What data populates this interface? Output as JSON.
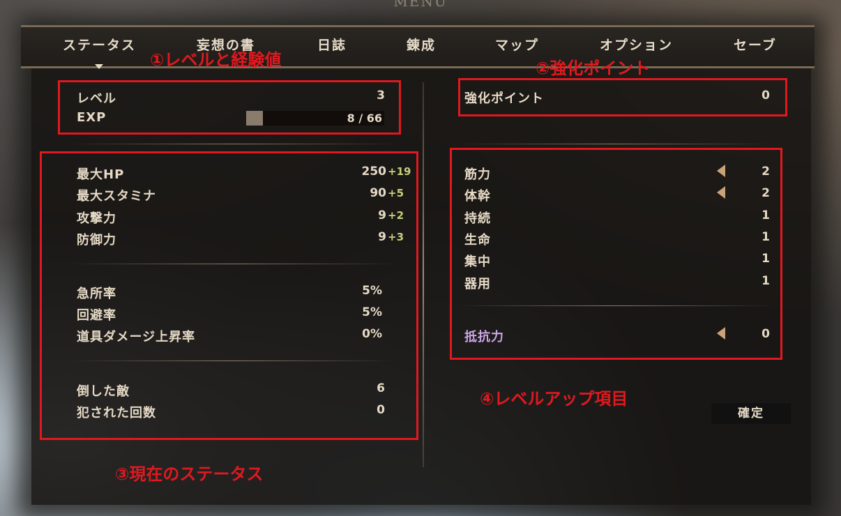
{
  "window": {
    "menu_title": "MENU"
  },
  "tabs": [
    {
      "label": "ステータス"
    },
    {
      "label": "妄想の書"
    },
    {
      "label": "日誌"
    },
    {
      "label": "錬成"
    },
    {
      "label": "マップ"
    },
    {
      "label": "オプション"
    },
    {
      "label": "セーブ"
    }
  ],
  "level_section": {
    "level_label": "レベル",
    "level_value": "3",
    "exp_label": "EXP",
    "exp_text": "8 / 66",
    "exp_current": 8,
    "exp_max": 66
  },
  "stats_primary": [
    {
      "label": "最大HP",
      "value": "250",
      "bonus": "+19"
    },
    {
      "label": "最大スタミナ",
      "value": "90",
      "bonus": "+5"
    },
    {
      "label": "攻撃力",
      "value": "9",
      "bonus": "+2"
    },
    {
      "label": "防御力",
      "value": "9",
      "bonus": "+3"
    }
  ],
  "stats_secondary": [
    {
      "label": "急所率",
      "value": "5%"
    },
    {
      "label": "回避率",
      "value": "5%"
    },
    {
      "label": "道具ダメージ上昇率",
      "value": "0%"
    }
  ],
  "stats_record": [
    {
      "label": "倒した敵",
      "value": "6"
    },
    {
      "label": "犯された回数",
      "value": "0"
    }
  ],
  "upgrade": {
    "label": "強化ポイント",
    "value": "0"
  },
  "attributes": [
    {
      "label": "筋力",
      "value": "2",
      "arrow": true
    },
    {
      "label": "体幹",
      "value": "2",
      "arrow": true
    },
    {
      "label": "持続",
      "value": "1",
      "arrow": false
    },
    {
      "label": "生命",
      "value": "1",
      "arrow": false
    },
    {
      "label": "集中",
      "value": "1",
      "arrow": false
    },
    {
      "label": "器用",
      "value": "1",
      "arrow": false
    }
  ],
  "resistance": {
    "label": "抵抗力",
    "value": "0"
  },
  "confirm_label": "確定",
  "annotations": {
    "a1": "①レベルと経験値",
    "a2": "②強化ポイント",
    "a3": "③現在のステータス",
    "a4": "④レベルアップ項目"
  },
  "colors": {
    "annotation": "#e0191f",
    "bonus": "#c8cf7c",
    "resistance": "#c9a6e6"
  }
}
